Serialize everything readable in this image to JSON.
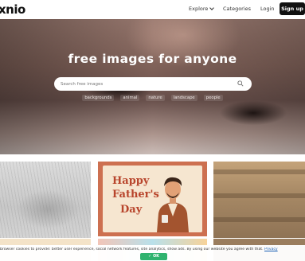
{
  "header": {
    "logo": "xnio",
    "nav": {
      "explore": "Explore",
      "categories": "Categories",
      "login": "Login",
      "signup": "Sign up"
    }
  },
  "hero": {
    "title": "free images for anyone",
    "search": {
      "placeholder": "Search free images"
    },
    "tags": [
      "backgrounds",
      "animal",
      "nature",
      "landscape",
      "people"
    ]
  },
  "gallery": {
    "card": {
      "line1": "Happy",
      "line2": "Father's",
      "line3": "Day"
    }
  },
  "cookie": {
    "text": "browser cookies to provide: better user experience, social network features, site analytics, show ads. By using our website you agree with that. ",
    "link": "Privacy",
    "ok": "OK",
    "ok_icon": "check-icon"
  },
  "colors": {
    "accent_dark": "#111111",
    "ok_green": "#2fb36f",
    "card_orange": "#cd7050"
  }
}
